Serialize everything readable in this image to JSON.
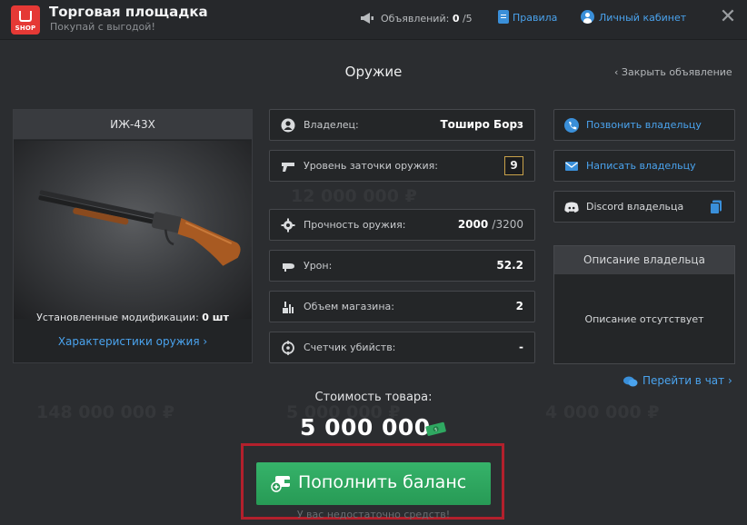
{
  "header": {
    "app_title": "Торговая площадка",
    "app_subtitle": "Покупай с выгодой!",
    "logo_text": "SHOP",
    "announcements_label": "Объявлений:",
    "announcements_count": "0",
    "announcements_max": "/5",
    "rules_link": "Правила",
    "cabinet_link": "Личный кабинет",
    "close_symbol": "✕"
  },
  "section_title": "Оружие",
  "close_listing_link": "‹ Закрыть объявление",
  "background_ghost": {
    "top_price": "12 000 000 ₽",
    "left_price": "148 000 000 ₽",
    "center_price": "5 000 000 ₽",
    "right_price": "4 000 000 ₽"
  },
  "weapon": {
    "name": "ИЖ-43Х",
    "mods_label": "Установленные модификации:",
    "mods_value": "0 шт",
    "stats_link": "Характеристики оружия ›"
  },
  "stats": {
    "owner": {
      "label": "Владелец:",
      "value": "Тоширо Борз",
      "icon": "user-circle-icon"
    },
    "sharpening": {
      "label": "Уровень заточки оружия:",
      "value": "9",
      "icon": "gun-icon"
    },
    "durability": {
      "label": "Прочность оружия:",
      "value": "2000",
      "max": "/3200",
      "icon": "gear-icon"
    },
    "damage": {
      "label": "Урон:",
      "value": "52.2",
      "icon": "bullet-icon"
    },
    "magazine": {
      "label": "Объем магазина:",
      "value": "2",
      "icon": "magazine-icon"
    },
    "kills": {
      "label": "Счетчик убийств:",
      "value": "-",
      "icon": "crosshair-icon"
    }
  },
  "contacts": {
    "call": {
      "label": "Позвонить владельцу",
      "icon": "phone-icon"
    },
    "message": {
      "label": "Написать владельцу",
      "icon": "mail-icon"
    },
    "discord": {
      "label": "Discord владельца",
      "icon": "discord-icon"
    }
  },
  "owner_description": {
    "title": "Описание владельца",
    "text": "Описание отсутствует"
  },
  "chat_link": "Перейти в чат ›",
  "price": {
    "label": "Стоимость товара:",
    "value": "5 000 000"
  },
  "topup_button": "Пополнить баланс",
  "insufficient_funds": "У вас недостаточно средств!",
  "colors": {
    "accent_blue": "#4aa3ee",
    "button_green": "#2fa861",
    "highlight_red": "#b3202c",
    "logo_red": "#e53935",
    "level_border": "#c9a24a"
  }
}
